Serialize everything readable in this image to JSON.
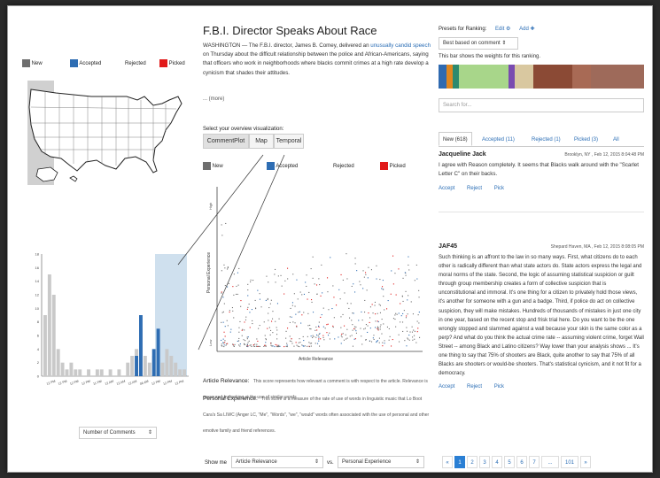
{
  "left": {
    "legend": [
      "New",
      "Accepted",
      "Rejected",
      "Picked"
    ],
    "histogram": {
      "y_ticks": [
        "18",
        "16",
        "14",
        "12",
        "10",
        "8",
        "6",
        "4",
        "2",
        "0"
      ],
      "x_ticks": [
        "12 PM",
        "12 PM",
        "12 PM",
        "12 PM",
        "11 PM",
        "12 AM",
        "12 AM",
        "12 AM",
        "06 AM",
        "12 PM",
        "12 PM",
        "12 PM"
      ],
      "bars": [
        9,
        15,
        12,
        4,
        2,
        1,
        2,
        1,
        1,
        0,
        1,
        0,
        1,
        1,
        0,
        1,
        0,
        1,
        0,
        2,
        3,
        4,
        7,
        3,
        2,
        3,
        4,
        2,
        4,
        3,
        2,
        1,
        1
      ],
      "accepted_bars": [
        0,
        0,
        0,
        0,
        0,
        0,
        0,
        0,
        0,
        0,
        0,
        0,
        0,
        0,
        0,
        0,
        0,
        0,
        0,
        0,
        0,
        3,
        9,
        0,
        0,
        4,
        7,
        0,
        0,
        0,
        0,
        0,
        0
      ]
    },
    "select_label": "Number of Comments"
  },
  "middle": {
    "title": "F.B.I. Director Speaks About Race",
    "article_lead": "WASHINGTON — The F.B.I. director, James B. Comey, delivered an",
    "article_link": "unusually candid speech",
    "article_rest": "on Thursday about the difficult relationship between the police and African-Americans, saying that officers who work in neighborhoods where blacks commit crimes at a high rate develop a cynicism that shades their attitudes.",
    "more_link": "(more)",
    "viz_label": "Select your overview visualization:",
    "viz_buttons": [
      "CommentPlot",
      "Map",
      "Temporal"
    ],
    "legend": [
      "New",
      "Accepted",
      "Rejected",
      "Picked"
    ],
    "scatter": {
      "x_label": "Article Relevance",
      "y_label": "Personal Experience",
      "y_top": "High",
      "y_bottom": "Low"
    },
    "desc1_title": "Article Relevance:",
    "desc1_text": "This score represents how relevant a comment is with respect to the article. Relevance is measured by looking at the use of similar words.",
    "desc2_title": "Personal Experience:",
    "desc2_text": "This score is a measure of the rate of use of words in linguistic music that Lo Boot Cara's Sa LIWC (Anger LC, \"Me\", \"Words\", \"we\", \"would\" words often associated with the use of personal and other emotive family and friend references.",
    "show_me": "Show me",
    "vs": "vs.",
    "x_select": "Article Relevance",
    "y_select": "Personal Experience"
  },
  "right": {
    "presets_label": "Presets for Ranking:",
    "edit": "Edit",
    "add": "Add",
    "preset_select": "Best based on comment",
    "weights_caption": "This bar shows the weights for this ranking.",
    "weights": [
      {
        "color": "#2f6ab0",
        "w": 4
      },
      {
        "color": "#e0871f",
        "w": 3
      },
      {
        "color": "#2e8a6e",
        "w": 3
      },
      {
        "color": "#a8d68a",
        "w": 24
      },
      {
        "color": "#7a4bb0",
        "w": 3
      },
      {
        "color": "#d9c8a0",
        "w": 9
      },
      {
        "color": "#8b4a35",
        "w": 19
      },
      {
        "color": "#a86a55",
        "w": 9
      },
      {
        "color": "#9e6a5a",
        "w": 26
      }
    ],
    "search_placeholder": "Search for...",
    "tabs": [
      "New (618)",
      "Accepted (11)",
      "Rejected (1)",
      "Picked (3)",
      "All"
    ],
    "comments": [
      {
        "author": "Jacqueline Jack",
        "meta": "Brooklyn, NY , Feb 12, 2015 8:04:48 PM",
        "text": "I agree with Reason completely. It seems that Blacks walk around with the \"Scarlet Letter C\" on their backs.",
        "actions": [
          "Accept",
          "Reject",
          "Pick"
        ]
      },
      {
        "author": "JAF45",
        "meta": "Shepard Haven, MA , Feb 12, 2015 8:08:05 PM",
        "text": "Such thinking is an affront to the law in so many ways. First, what citizens do to each other is radically different than what state actors do. State actors express the legal and moral norms of the state. Second, the logic of assuming statistical suspicion or guilt through group membership creates a form of collective suspicion that is unconstitutional and immoral. It's one thing for a citizen to privately hold those views, it's another for someone with a gun and a badge. Third, if police do act on collective suspicion, they will make mistakes. Hundreds of thousands of mistakes in just one city in one year, based on the recent stop and frisk trial here. Do you want to be the one wrongly stopped and slammed against a wall because your skin is the same color as a perp? And what do you think the actual crime rate -- assuming violent crime, forget Wall Street -- among Black and Latino citizens? Way lower than your analysis shows ... It's one thing to say that 75% of shooters are Black, quite another to say that 75% of all Blacks are shooters or would-be shooters. That's statistical cynicism, and it not fit for a democracy.",
        "actions": [
          "Accept",
          "Reject",
          "Pick"
        ]
      }
    ],
    "pages": [
      "«",
      "1",
      "2",
      "3",
      "4",
      "5",
      "6",
      "7",
      "...",
      "101",
      "»"
    ]
  },
  "colors": {
    "new": "#6e6e6e",
    "accepted": "#2e6db3",
    "rejected": "#ffffff",
    "picked": "#e11a1a",
    "link": "#2a6db5",
    "highlight": "#cfe0ee"
  }
}
